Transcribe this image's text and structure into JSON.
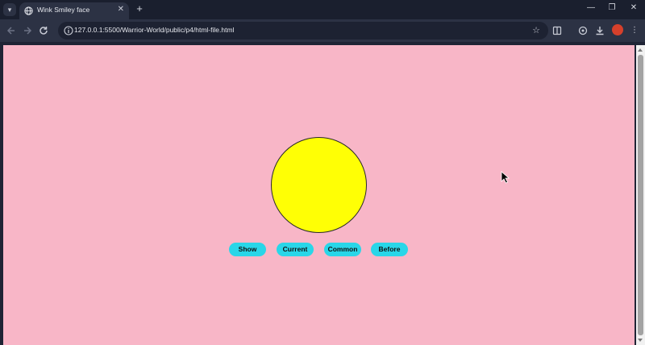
{
  "browser": {
    "tab": {
      "title": "Wink Smiley face",
      "close_glyph": "✕"
    },
    "new_tab_glyph": "+",
    "window_controls": {
      "minimize": "—",
      "restore": "❐",
      "close": "✕"
    },
    "address_bar": {
      "url": "127.0.0.1:5500/Warrior-World/public/p4/html-file.html"
    },
    "icons": [
      "tab-search-icon",
      "favicon-globe-icon",
      "back-arrow-icon",
      "forward-arrow-icon",
      "reload-icon",
      "site-info-icon",
      "bookmark-star-icon",
      "reading-list-icon",
      "extensions-icon",
      "downloads-icon",
      "profile-extension-icon",
      "more-menu-icon"
    ]
  },
  "page": {
    "background": "#f8b6c7",
    "face": {
      "color": "#ffff05"
    },
    "buttons": [
      {
        "label": "Show"
      },
      {
        "label": "Current"
      },
      {
        "label": "Common"
      },
      {
        "label": "Before"
      }
    ],
    "button_color": "#29d6e8"
  }
}
